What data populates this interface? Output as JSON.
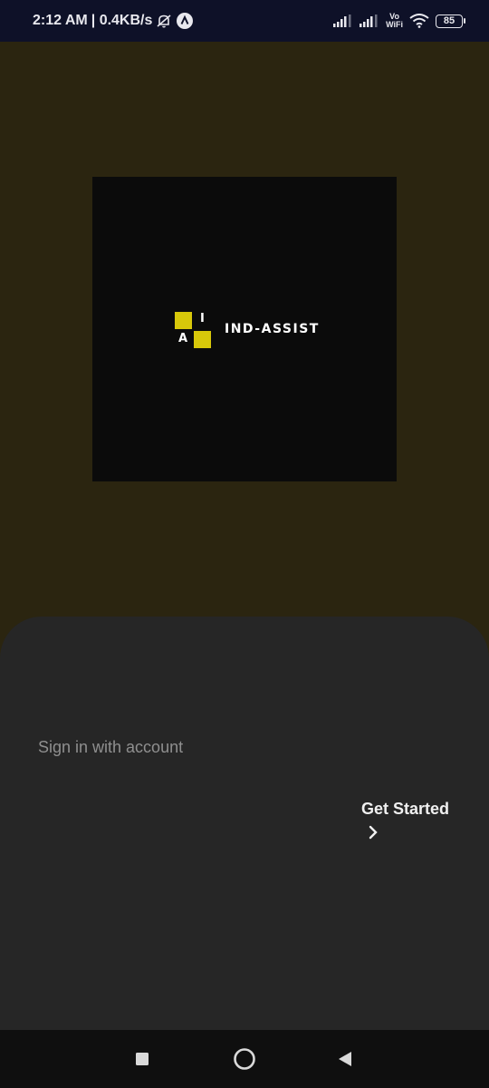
{
  "status_bar": {
    "time": "2:12 AM",
    "speed": "| 0.4KB/s",
    "vowifi_top": "Vo",
    "vowifi_bottom": "WiFi",
    "battery": "85",
    "icons": [
      "bell-off-icon",
      "app-notification-icon",
      "signal-icon",
      "signal-icon",
      "wifi-icon",
      "battery-icon"
    ]
  },
  "logo": {
    "letter_i": "I",
    "letter_a": "A",
    "brand": "IND-ASSIST",
    "accent_color": "#d8c80a"
  },
  "sheet": {
    "signin_label": "Sign in with account",
    "get_started_label": "Get Started"
  },
  "nav": {
    "buttons": [
      "recents-icon",
      "home-icon",
      "back-icon"
    ]
  },
  "colors": {
    "hero_background": "#2b2510",
    "sheet_background": "#262626",
    "status_bar_background": "#0e1128"
  }
}
